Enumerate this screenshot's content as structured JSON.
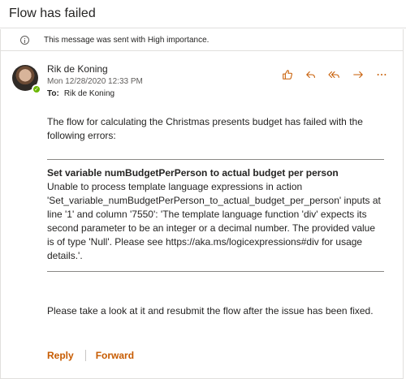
{
  "message": {
    "subject": "Flow has failed",
    "importance_notice": "This message was sent with High importance.",
    "sender": "Rik de Koning",
    "date": "Mon 12/28/2020 12:33 PM",
    "to_label": "To:",
    "to": "Rik de Koning"
  },
  "actions": {
    "like": "like-icon",
    "reply": "reply-icon",
    "reply_all": "reply-all-icon",
    "forward": "forward-icon",
    "more": "more-icon"
  },
  "body": {
    "intro": "The flow for calculating the Christmas presents budget has failed with the following errors:",
    "error_title": "Set variable numBudgetPerPerson to actual budget per person",
    "error_detail": "Unable to process template language expressions in action 'Set_variable_numBudgetPerPerson_to_actual_budget_per_person' inputs at line '1' and column '7550': 'The template language function 'div' expects its second parameter to be an integer or a decimal number. The provided value is of type 'Null'. Please see https://aka.ms/logicexpressions#div for usage details.'.",
    "closing": "Please take a look at it and resubmit the flow after the issue has been fixed."
  },
  "footer": {
    "reply": "Reply",
    "forward": "Forward"
  },
  "colors": {
    "accent": "#c75b00",
    "presence": "#6bb700"
  }
}
